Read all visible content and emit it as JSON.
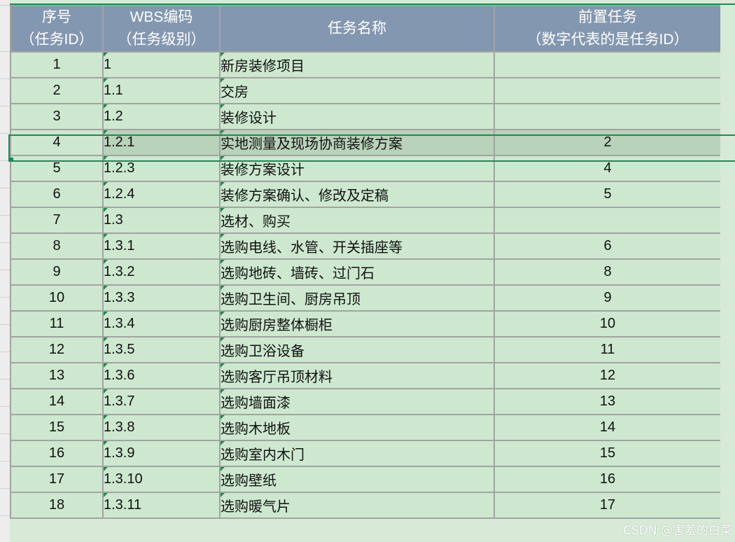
{
  "headers": {
    "id": [
      "序号",
      "（任务ID）"
    ],
    "wbs": [
      "WBS编码",
      "（任务级别）"
    ],
    "name": [
      "任务名称"
    ],
    "pre": [
      "前置任务",
      "（数字代表的是任务ID）"
    ]
  },
  "rows": [
    {
      "id": "1",
      "wbs": "1",
      "name": "新房装修项目",
      "pre": ""
    },
    {
      "id": "2",
      "wbs": "1.1",
      "name": "交房",
      "pre": ""
    },
    {
      "id": "3",
      "wbs": "1.2",
      "name": "装修设计",
      "pre": ""
    },
    {
      "id": "4",
      "wbs": "1.2.1",
      "name": "实地测量及现场协商装修方案",
      "pre": "2"
    },
    {
      "id": "5",
      "wbs": "1.2.3",
      "name": "装修方案设计",
      "pre": "4"
    },
    {
      "id": "6",
      "wbs": "1.2.4",
      "name": "装修方案确认、修改及定稿",
      "pre": "5"
    },
    {
      "id": "7",
      "wbs": "1.3",
      "name": "选材、购买",
      "pre": ""
    },
    {
      "id": "8",
      "wbs": "1.3.1",
      "name": "选购电线、水管、开关插座等",
      "pre": "6"
    },
    {
      "id": "9",
      "wbs": "1.3.2",
      "name": "选购地砖、墙砖、过门石",
      "pre": "8"
    },
    {
      "id": "10",
      "wbs": "1.3.3",
      "name": "选购卫生间、厨房吊顶",
      "pre": "9"
    },
    {
      "id": "11",
      "wbs": "1.3.4",
      "name": "选购厨房整体橱柜",
      "pre": "10"
    },
    {
      "id": "12",
      "wbs": "1.3.5",
      "name": "选购卫浴设备",
      "pre": "11"
    },
    {
      "id": "13",
      "wbs": "1.3.6",
      "name": "选购客厅吊顶材料",
      "pre": "12"
    },
    {
      "id": "14",
      "wbs": "1.3.7",
      "name": "选购墙面漆",
      "pre": "13"
    },
    {
      "id": "15",
      "wbs": "1.3.8",
      "name": "选购木地板",
      "pre": "14"
    },
    {
      "id": "16",
      "wbs": "1.3.9",
      "name": "选购室内木门",
      "pre": "15"
    },
    {
      "id": "17",
      "wbs": "1.3.10",
      "name": "选购壁纸",
      "pre": "16"
    },
    {
      "id": "18",
      "wbs": "1.3.11",
      "name": "选购暖气片",
      "pre": "17"
    }
  ],
  "selected_row": "4",
  "watermark": "CSDN @害羞的白菜",
  "colors": {
    "header_bg": "#8497b0",
    "cell_bg": "#cde8cf",
    "selected_bg": "#b9d2ba",
    "selection_border": "#1e8a55"
  }
}
